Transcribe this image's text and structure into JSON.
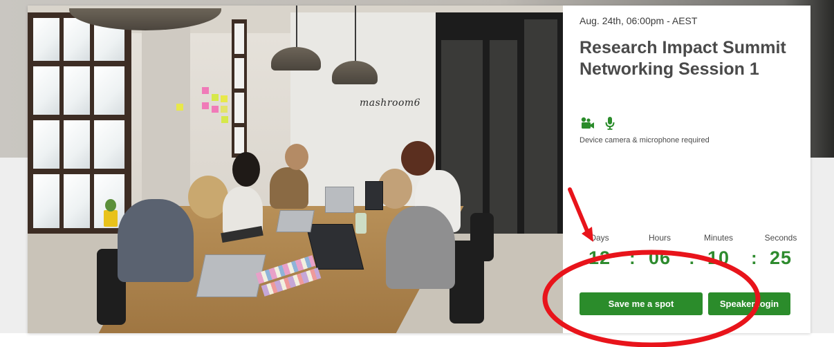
{
  "event": {
    "datetime": "Aug. 24th, 06:00pm - AEST",
    "title": "Research Impact Summit Networking Session 1",
    "requirements_text": "Device camera & microphone required",
    "requirement_icons": [
      "video-camera-icon",
      "microphone-icon"
    ],
    "photo_brand_text": "mashroom6"
  },
  "countdown": {
    "units": [
      {
        "label": "Days",
        "value": "12"
      },
      {
        "label": "Hours",
        "value": "06"
      },
      {
        "label": "Minutes",
        "value": "10"
      },
      {
        "label": "Seconds",
        "value": "25"
      }
    ],
    "separator": ":"
  },
  "actions": {
    "save_label": "Save me a spot",
    "speaker_label": "Speaker login"
  },
  "colors": {
    "accent_green": "#2b8c2b",
    "countdown_green": "#2e8b2e",
    "annotation_red": "#e8141b"
  }
}
